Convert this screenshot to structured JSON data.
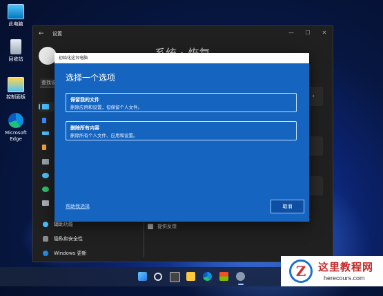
{
  "desktop": {
    "icons": [
      {
        "label": "此电脑",
        "icon": "this-pc-icon"
      },
      {
        "label": "回收站",
        "icon": "recycle-bin-icon"
      },
      {
        "label": "控制面板",
        "icon": "control-panel-icon"
      },
      {
        "label": "Microsoft Edge",
        "icon": "edge-icon"
      }
    ]
  },
  "settings": {
    "title": "设置",
    "search_placeholder": "查找设置",
    "heading": "系统 › 恢复",
    "nav": [
      {
        "label": "辅助功能",
        "color": "#4cc2ff"
      },
      {
        "label": "隐私和安全性",
        "color": "#8a8a8a"
      },
      {
        "label": "Windows 更新",
        "color": "#1e88e5"
      }
    ],
    "feedback": "提供反馈"
  },
  "dialog": {
    "window_title": "初始化这台电脑",
    "heading": "选择一个选项",
    "options": [
      {
        "title": "保留我的文件",
        "desc": "删除应用和设置，但保留个人文件。"
      },
      {
        "title": "删除所有内容",
        "desc": "删除所有个人文件、应用和设置。"
      }
    ],
    "help_link": "帮助我选择",
    "cancel": "取消"
  },
  "watermark": {
    "cn": "这里教程网",
    "en": "herecours.com",
    "logo_letter": "Z"
  },
  "colors": {
    "dialog_bg": "#1565c0",
    "settings_bg": "#202020",
    "accent": "#4cc2ff"
  }
}
